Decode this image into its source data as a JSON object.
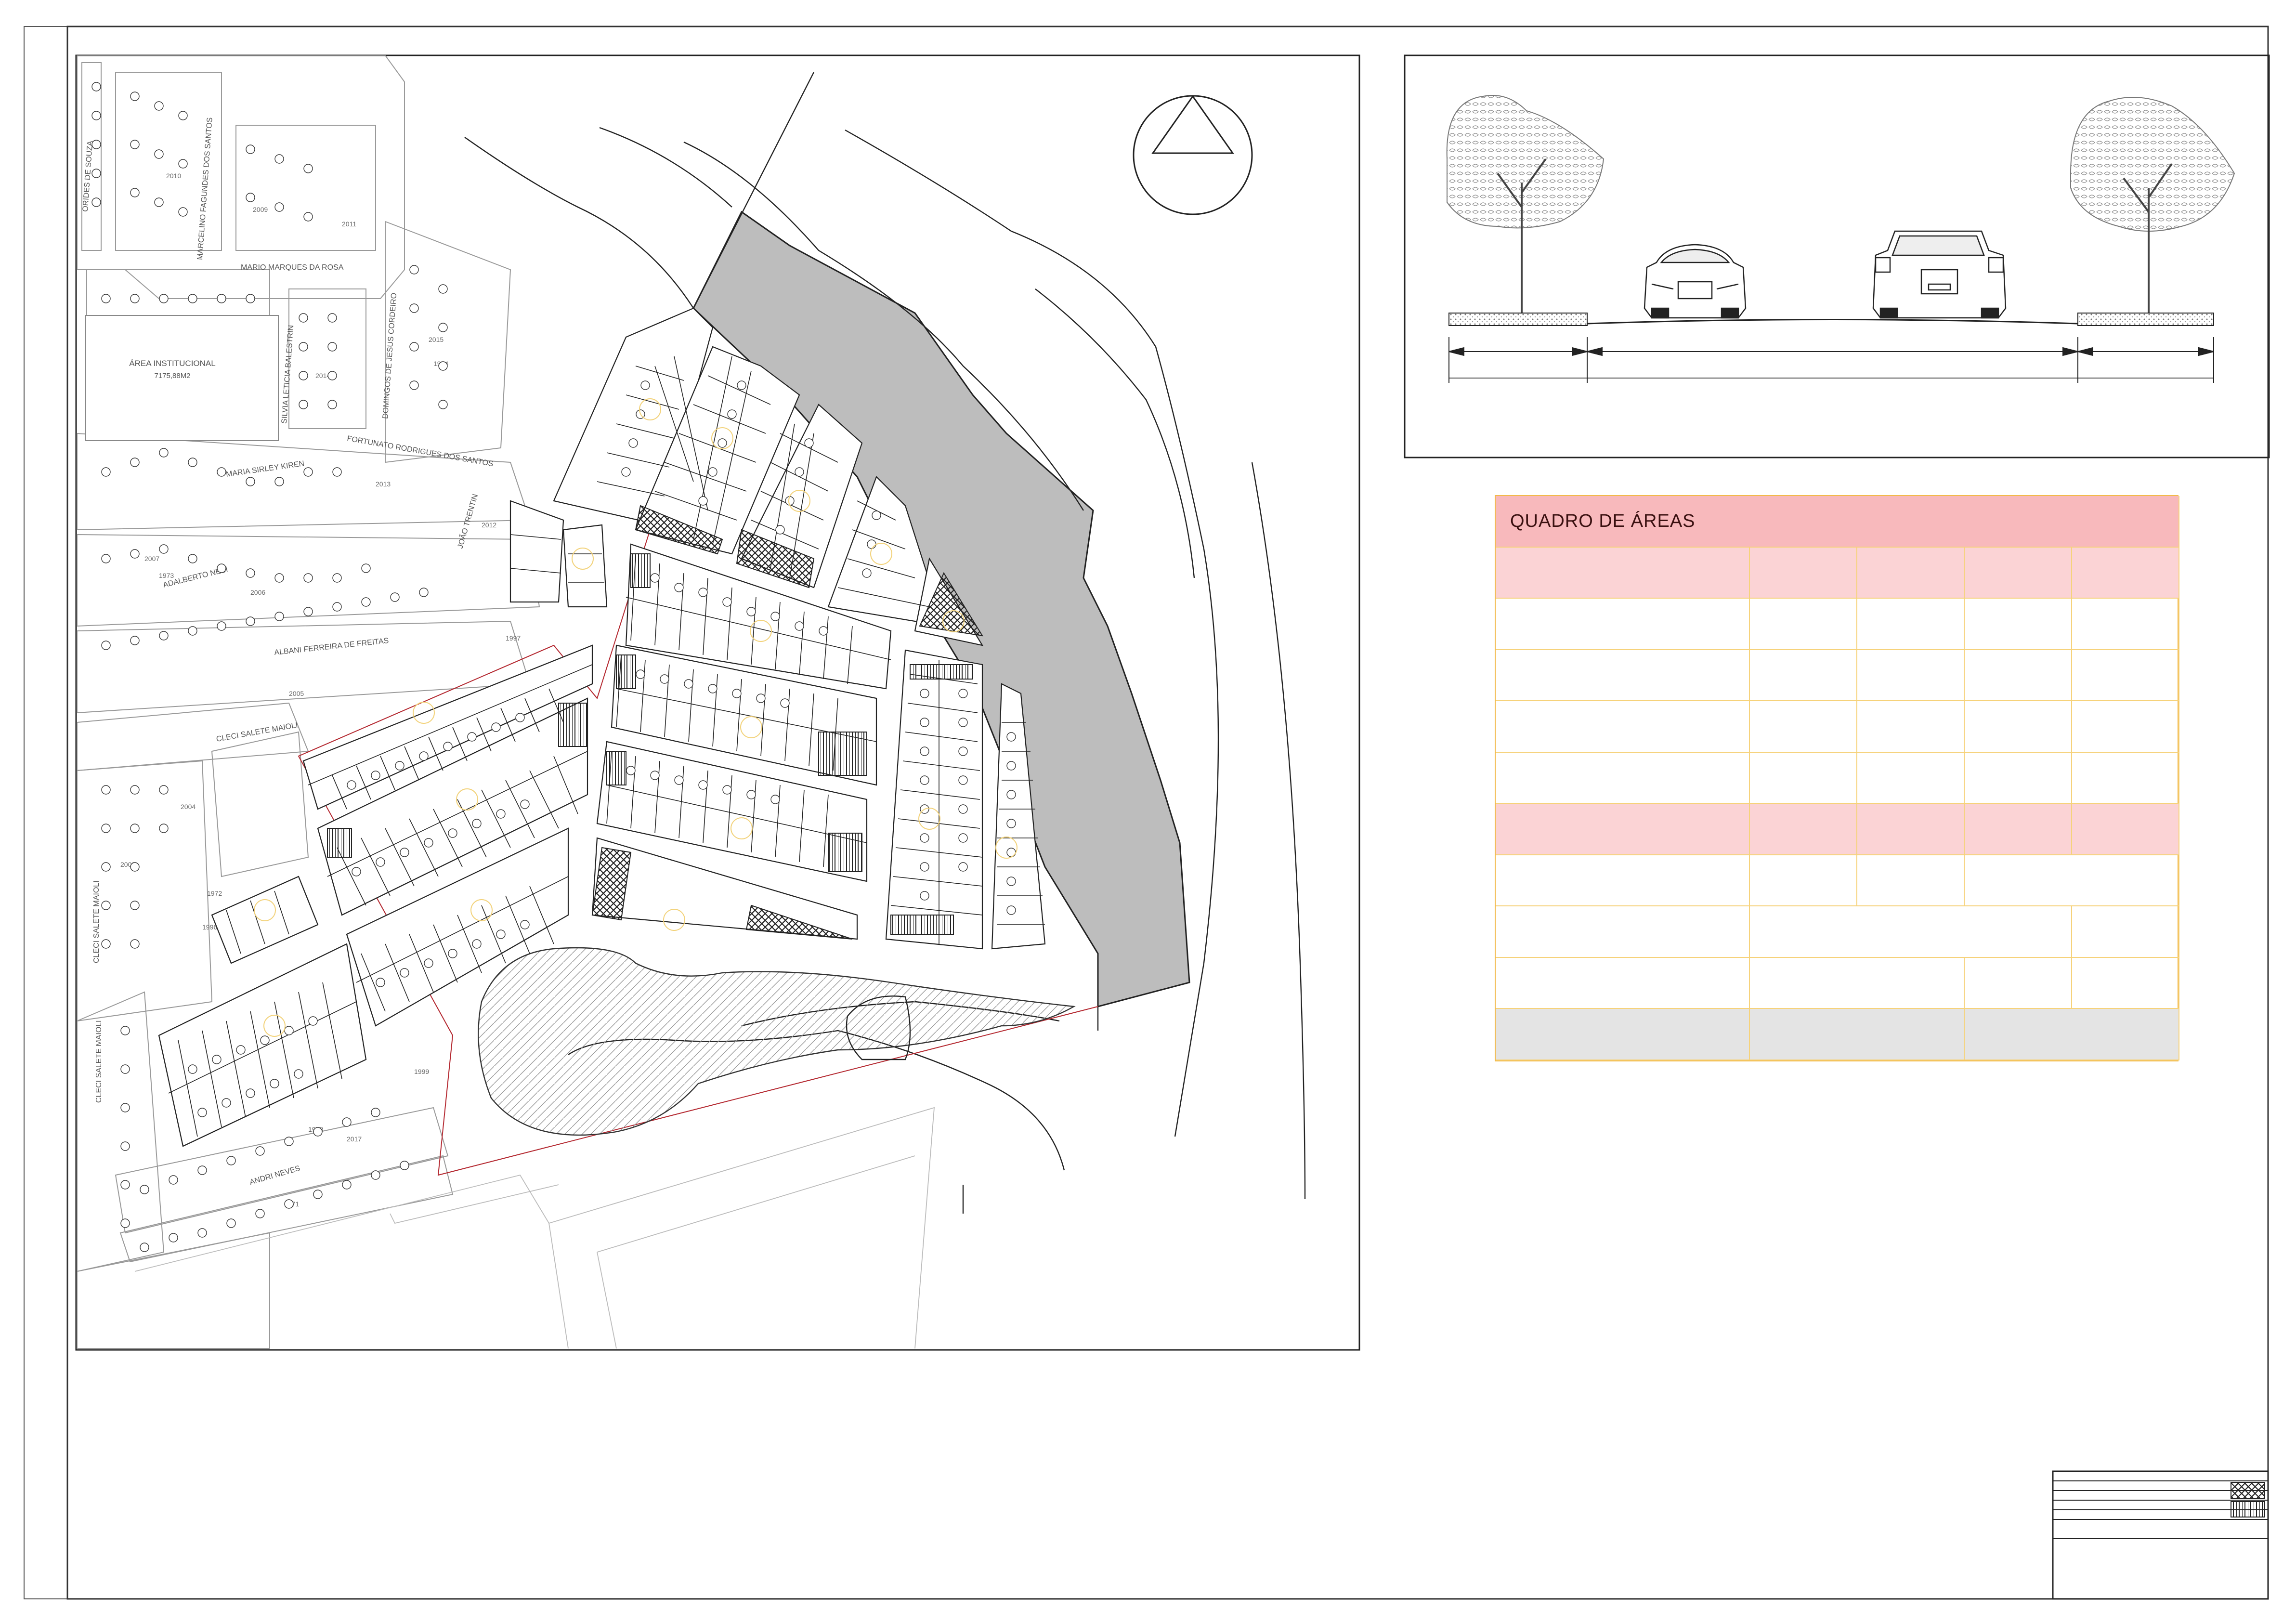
{
  "drawing": {
    "north_arrow": "north-arrow-icon",
    "map_labels": {
      "institutional_area": "ÁREA INSTITUCIONAL",
      "institutional_area_size": "7175,88M2",
      "streets": [
        "MARIO MARQUES DA ROSA",
        "MARIA SIRLEY KIREN",
        "ADALBERTO NESI",
        "ALBANI FERREIRA DE FREITAS",
        "CLECI SALETE MAIOLI",
        "CLECI SALETE MAIOLI",
        "CLECI SALETE MAIOLI",
        "ANDRI NEVES",
        "SILVIA LETICIA BALESTRIN",
        "DOMINGOS DE JESUS CORDEIRO",
        "FORTUNATO RODRIGUES DOS SANTOS",
        "JOÃO TRENTIN",
        "MARCELINO FAGUNDES DOS SANTOS",
        "ORIDES DE SOUZA"
      ],
      "block_numbers": [
        "2010",
        "2009",
        "2011",
        "2014",
        "2015",
        "2012",
        "2013",
        "2007",
        "2006",
        "2005",
        "2004",
        "2003",
        "1996",
        "1997",
        "1999",
        "1998",
        "2017",
        "1971",
        "1972",
        "1973",
        "1974"
      ]
    }
  },
  "road_section": {
    "icons": [
      "tree-icon",
      "car-front-icon",
      "car-rear-icon",
      "tree-icon"
    ]
  },
  "areas_table": {
    "title": "QUADRO DE ÁREAS"
  },
  "colors": {
    "table_header": "#f8b9bc",
    "table_subheader": "#fbd3d5",
    "table_total": "#e4e4e4",
    "table_grid": "#f6d27a",
    "preserved_area": "#bdbdbd",
    "boundary_line": "#b3262e"
  }
}
